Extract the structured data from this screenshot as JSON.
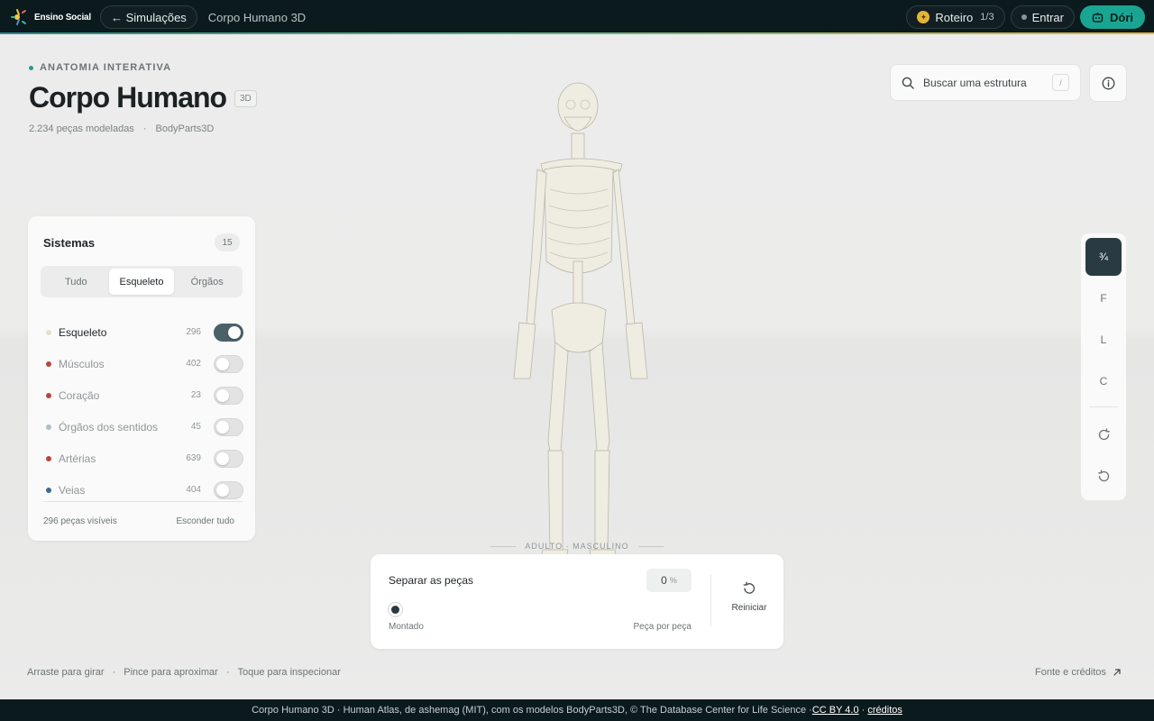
{
  "topbar": {
    "logo_text": "Ensino Social",
    "back_label": "← Simulações",
    "page_title": "Corpo Humano 3D",
    "roteiro_label": "Roteiro",
    "roteiro_count": "1/3",
    "login_label": "Entrar",
    "assistant_label": "Dóri"
  },
  "header": {
    "eyebrow": "ANATOMIA INTERATIVA",
    "title": "Corpo Humano",
    "tag": "3D",
    "pieces": "2.234 peças modeladas",
    "separator": "·",
    "source": "BodyParts3D"
  },
  "search": {
    "placeholder": "Buscar uma estrutura",
    "shortcut": "/"
  },
  "systems": {
    "title": "Sistemas",
    "count": "15",
    "tabs": [
      {
        "label": "Tudo"
      },
      {
        "label": "Esqueleto"
      },
      {
        "label": "Órgãos"
      }
    ],
    "active_tab": "Esqueleto",
    "items": [
      {
        "name": "Esqueleto",
        "count": "296",
        "on": true,
        "color": "#e6dfc6"
      },
      {
        "name": "Músculos",
        "count": "402",
        "on": false,
        "color": "#b5483f"
      },
      {
        "name": "Coração",
        "count": "23",
        "on": false,
        "color": "#b5483f"
      },
      {
        "name": "Órgãos dos sentidos",
        "count": "45",
        "on": false,
        "color": "#a9c0c4"
      },
      {
        "name": "Artérias",
        "count": "639",
        "on": false,
        "color": "#b5483f"
      },
      {
        "name": "Veias",
        "count": "404",
        "on": false,
        "color": "#3e6a8a"
      }
    ],
    "visible_label": "296 peças visíveis",
    "hide_all_label": "Esconder tudo"
  },
  "views": [
    {
      "label": "¾",
      "active": true
    },
    {
      "label": "F",
      "active": false
    },
    {
      "label": "L",
      "active": false
    },
    {
      "label": "C",
      "active": false
    }
  ],
  "model": {
    "ground_label": "ADULTO · MASCULINO"
  },
  "separate": {
    "title": "Separar as peças",
    "value": "0",
    "unit": "%",
    "left_label": "Montado",
    "right_label": "Peça por peça",
    "reset_label": "Reiniciar"
  },
  "hints": {
    "drag": "Arraste para girar",
    "pinch": "Pince para aproximar",
    "tap": "Toque para inspecionar",
    "sep": "·",
    "credits": "Fonte e créditos"
  },
  "footer": {
    "text": "Corpo Humano 3D · Human Atlas, de ashemag (MIT), com os modelos BodyParts3D, © The Database Center for Life Science · ",
    "license": "CC BY 4.0",
    "mid": " · ",
    "credits": "créditos"
  },
  "colors": {
    "accent": "#1aa592",
    "topbar": "#0b1a1d",
    "toggle_on": "#4a6168"
  }
}
